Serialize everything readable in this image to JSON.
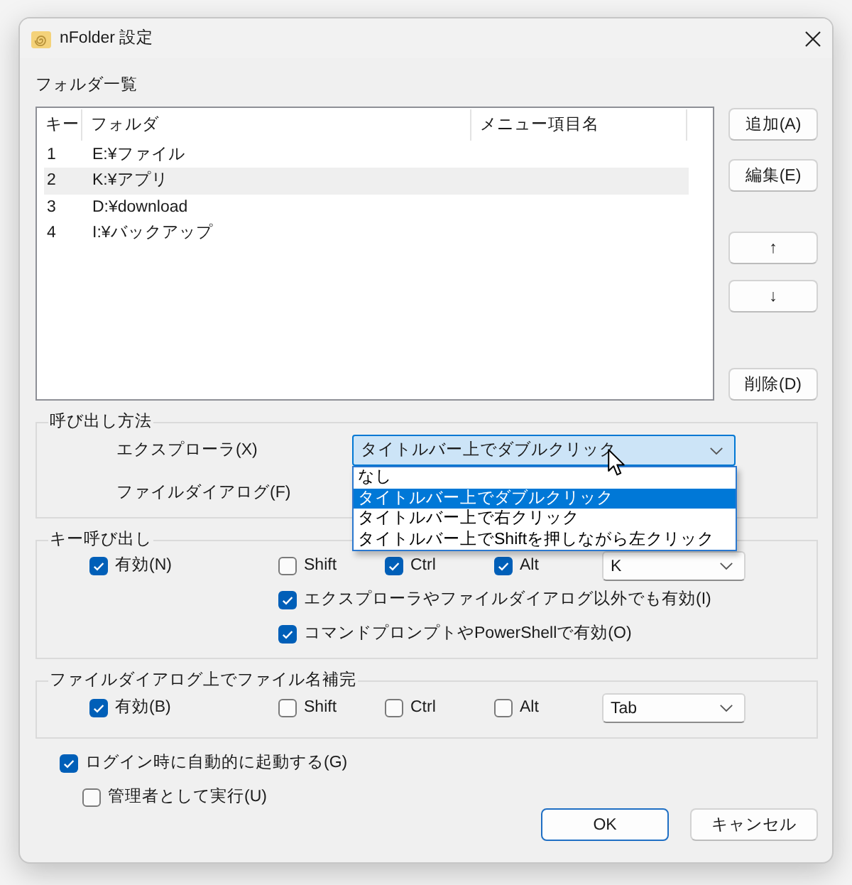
{
  "window": {
    "title": "nFolder 設定"
  },
  "folder_list": {
    "label": "フォルダ一覧",
    "columns": [
      "キー",
      "フォルダ",
      "メニュー項目名"
    ],
    "rows": [
      {
        "cells": [
          "1",
          "E:¥ファイル"
        ],
        "selected": false
      },
      {
        "cells": [
          "2",
          "K:¥アプリ"
        ],
        "selected": true
      },
      {
        "cells": [
          "3",
          "D:¥download"
        ],
        "selected": false
      },
      {
        "cells": [
          "4",
          "I:¥バックアップ"
        ],
        "selected": false
      }
    ]
  },
  "side_buttons": [
    {
      "label": "追加(A)"
    },
    {
      "label": "編集(E)"
    },
    {
      "label": "↑"
    },
    {
      "label": "↓"
    },
    {
      "label": "削除(D)"
    }
  ],
  "call_method": {
    "title": "呼び出し方法",
    "rows": [
      {
        "label": "エクスプローラ(X)",
        "dropdown": {
          "value": "タイトルバー上でダブルクリック",
          "expanded": true,
          "options": [
            {
              "label": "なし",
              "selected": false
            },
            {
              "label": "タイトルバー上でダブルクリック",
              "selected": true
            },
            {
              "label": "タイトルバー上で右クリック",
              "selected": false
            },
            {
              "label": "タイトルバー上でShiftを押しながら左クリック",
              "selected": false
            }
          ]
        }
      },
      {
        "label": "ファイルダイアログ(F)"
      }
    ]
  },
  "key_call": {
    "title": "キー呼び出し",
    "checkboxes": [
      {
        "label": "有効(N)",
        "checked": true
      },
      {
        "label": "Shift",
        "checked": false
      },
      {
        "label": "Ctrl",
        "checked": true
      },
      {
        "label": "Alt",
        "checked": true
      }
    ],
    "key": {
      "value": "K"
    },
    "extra_options": [
      {
        "label": "エクスプローラやファイルダイアログ以外でも有効(I)",
        "checked": true
      },
      {
        "label": "コマンドプロンプトやPowerShellで有効(O)",
        "checked": true
      }
    ]
  },
  "file_completion": {
    "title": "ファイルダイアログ上でファイル名補完",
    "checkboxes": [
      {
        "label": "有効(B)",
        "checked": true
      },
      {
        "label": "Shift",
        "checked": false
      },
      {
        "label": "Ctrl",
        "checked": false
      },
      {
        "label": "Alt",
        "checked": false
      }
    ],
    "key": {
      "value": "Tab"
    }
  },
  "startup": [
    {
      "label": "ログイン時に自動的に起動する(G)",
      "checked": true,
      "children": [
        {
          "label": "管理者として実行(U)",
          "checked": false
        }
      ]
    }
  ],
  "buttons": [
    {
      "label": "OK",
      "kind": "default"
    },
    {
      "label": "キャンセル",
      "kind": "normal"
    }
  ]
}
